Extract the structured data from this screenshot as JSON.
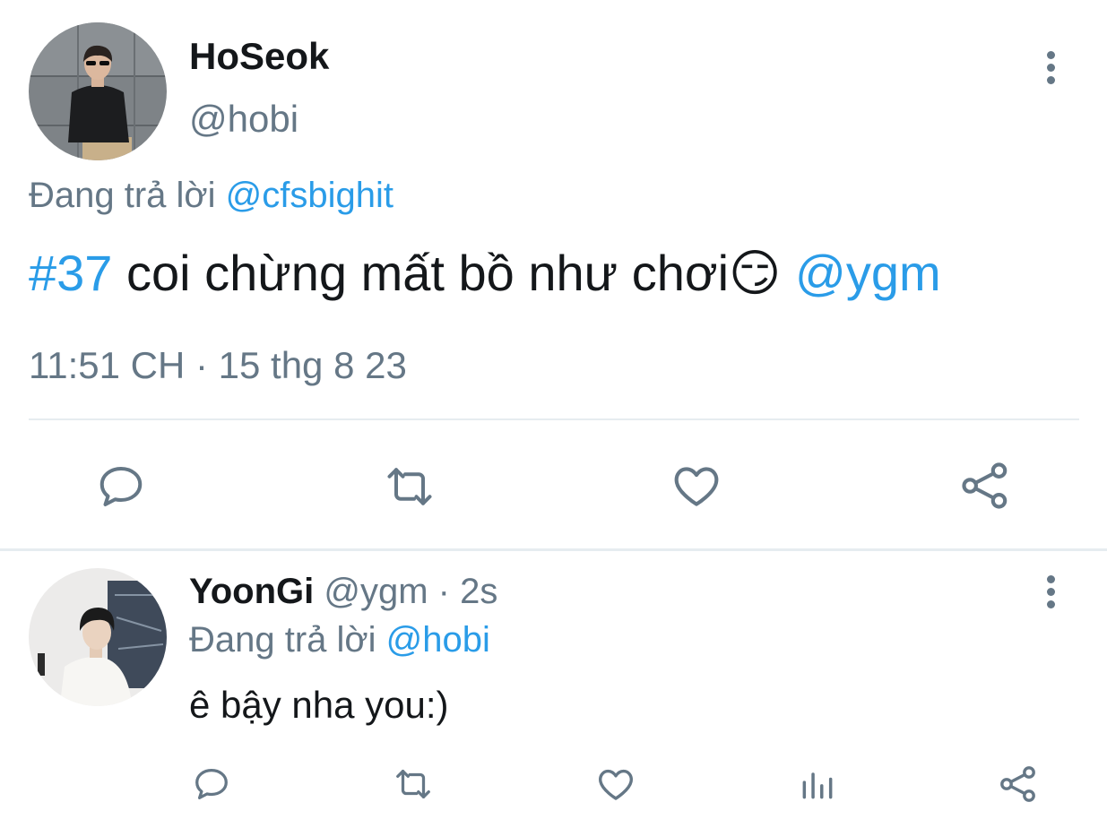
{
  "main_tweet": {
    "display_name": "HoSeok",
    "handle": "@hobi",
    "reply_prefix": "Đang trả lời",
    "reply_to": "@cfsbighit",
    "hashtag": "#37",
    "body_text": " coi chừng mất bồ như chơi",
    "emoji": "😏",
    "mention": "@ygm",
    "timestamp": "11:51 CH · 15 thg 8 23",
    "actions": [
      "reply-icon",
      "retweet-icon",
      "like-icon",
      "share-icon"
    ]
  },
  "reply_tweet": {
    "display_name": "YoonGi",
    "handle": "@ygm",
    "separator": "·",
    "time_ago": "2s",
    "reply_prefix": "Đang trả lời",
    "reply_to": "@hobi",
    "body_text": "ê bậy nha you:)",
    "actions": [
      "reply-icon",
      "retweet-icon",
      "like-icon",
      "analytics-icon",
      "share-icon"
    ]
  },
  "colors": {
    "link": "#2a9ce8",
    "muted": "#657786",
    "text": "#14171a",
    "divider": "#e6ecf0"
  }
}
